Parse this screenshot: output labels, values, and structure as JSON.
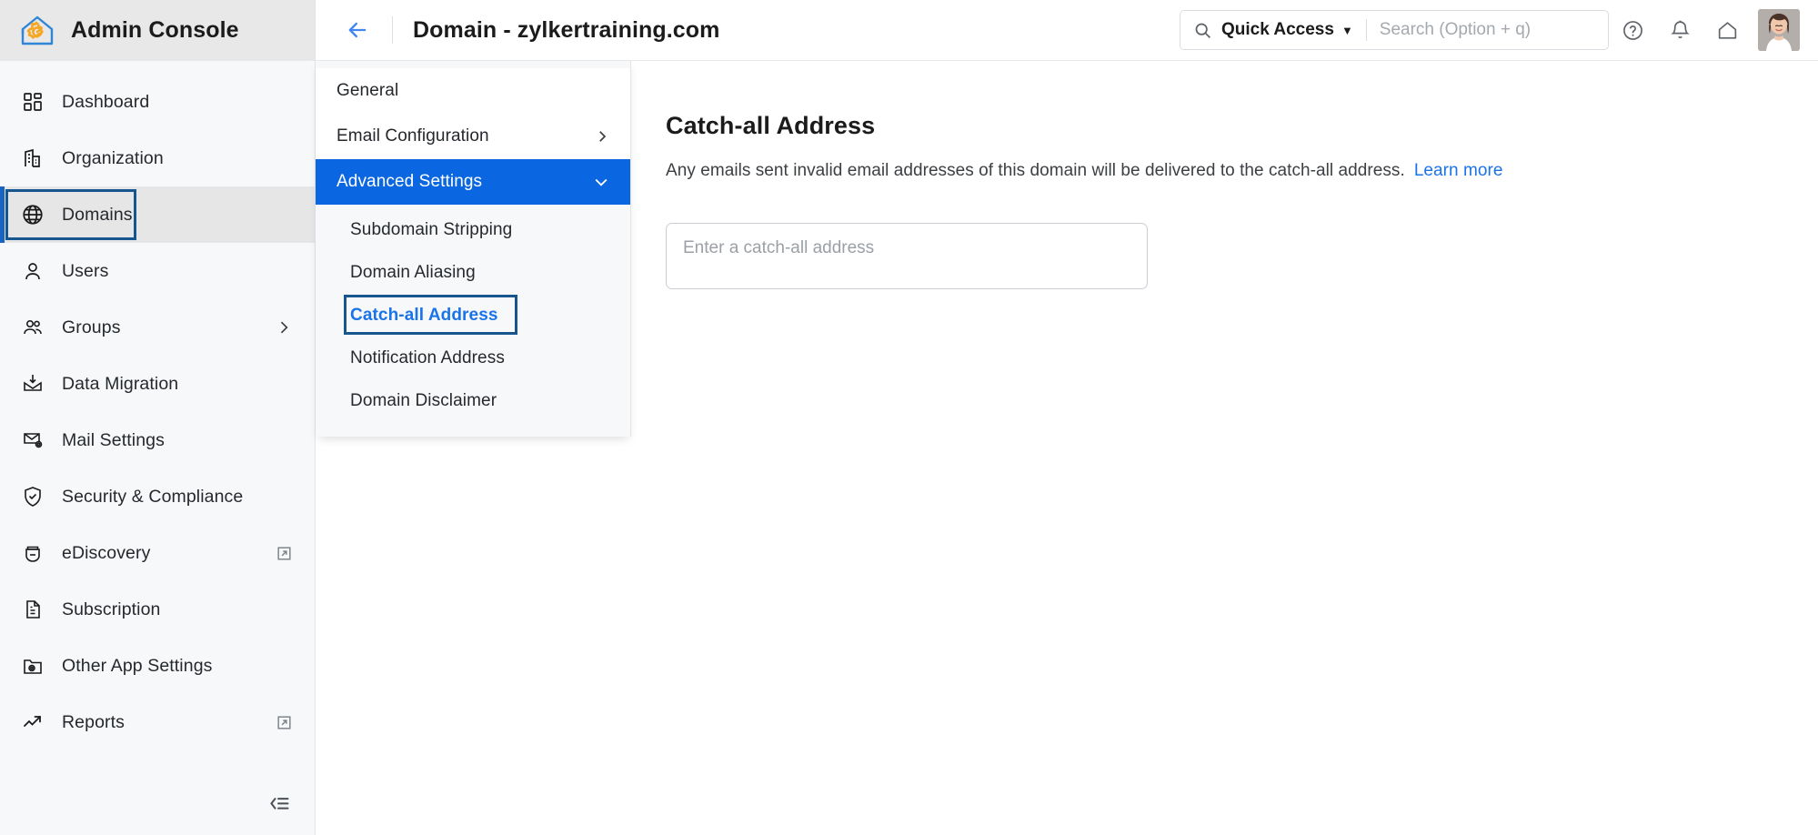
{
  "brand": {
    "title": "Admin Console",
    "logo_icon": "house-gear-logo",
    "logo_house_color": "#2f86d6",
    "logo_gear_color": "#f5a623"
  },
  "sidebar": {
    "items": [
      {
        "label": "Dashboard",
        "icon": "dashboard-grid-icon",
        "selected": false,
        "tail": ""
      },
      {
        "label": "Organization",
        "icon": "building-icon",
        "selected": false,
        "tail": ""
      },
      {
        "label": "Domains",
        "icon": "globe-icon",
        "selected": true,
        "tail": ""
      },
      {
        "label": "Users",
        "icon": "user-icon",
        "selected": false,
        "tail": ""
      },
      {
        "label": "Groups",
        "icon": "users-group-icon",
        "selected": false,
        "tail": "chevron-right-icon"
      },
      {
        "label": "Data Migration",
        "icon": "inbox-download-icon",
        "selected": false,
        "tail": ""
      },
      {
        "label": "Mail Settings",
        "icon": "mail-gear-icon",
        "selected": false,
        "tail": ""
      },
      {
        "label": "Security & Compliance",
        "icon": "shield-check-icon",
        "selected": false,
        "tail": ""
      },
      {
        "label": "eDiscovery",
        "icon": "ediscovery-icon",
        "selected": false,
        "tail": "external-link-icon"
      },
      {
        "label": "Subscription",
        "icon": "invoice-icon",
        "selected": false,
        "tail": ""
      },
      {
        "label": "Other App Settings",
        "icon": "folder-gear-icon",
        "selected": false,
        "tail": ""
      },
      {
        "label": "Reports",
        "icon": "trend-arrow-icon",
        "selected": false,
        "tail": "external-link-icon"
      }
    ],
    "collapse_icon": "collapse-menu-icon",
    "selected_accent": "#1765c0",
    "focus_ring_color": "#17558f"
  },
  "submenu": {
    "items": [
      {
        "label": "General",
        "state": "normal",
        "chevron": ""
      },
      {
        "label": "Email Configuration",
        "state": "normal",
        "chevron": "chevron-right-icon"
      },
      {
        "label": "Advanced Settings",
        "state": "active",
        "chevron": "chevron-down-icon"
      }
    ],
    "children": [
      {
        "label": "Subdomain Stripping",
        "current": false
      },
      {
        "label": "Domain Aliasing",
        "current": false
      },
      {
        "label": "Catch-all Address",
        "current": true
      },
      {
        "label": "Notification Address",
        "current": false
      },
      {
        "label": "Domain Disclaimer",
        "current": false
      }
    ],
    "active_bg": "#0a66e1",
    "current_text_color": "#1a73e8"
  },
  "topbar": {
    "back_icon": "back-arrow-icon",
    "title": "Domain - zylkertraining.com",
    "search": {
      "icon": "search-icon",
      "quick_access_label": "Quick Access",
      "quick_access_caret": "chevron-down-icon",
      "placeholder": "Search (Option + q)",
      "value": ""
    },
    "actions": [
      {
        "icon": "help-circle-icon",
        "name": "help-button"
      },
      {
        "icon": "bell-icon",
        "name": "notifications-button"
      },
      {
        "icon": "home-icon",
        "name": "home-button"
      }
    ],
    "avatar": "user-avatar"
  },
  "main": {
    "heading": "Catch-all Address",
    "description": "Any emails sent invalid email addresses of this domain will be delivered to the catch-all address.",
    "learn_more": "Learn more",
    "input_placeholder": "Enter a catch-all address",
    "input_value": ""
  }
}
